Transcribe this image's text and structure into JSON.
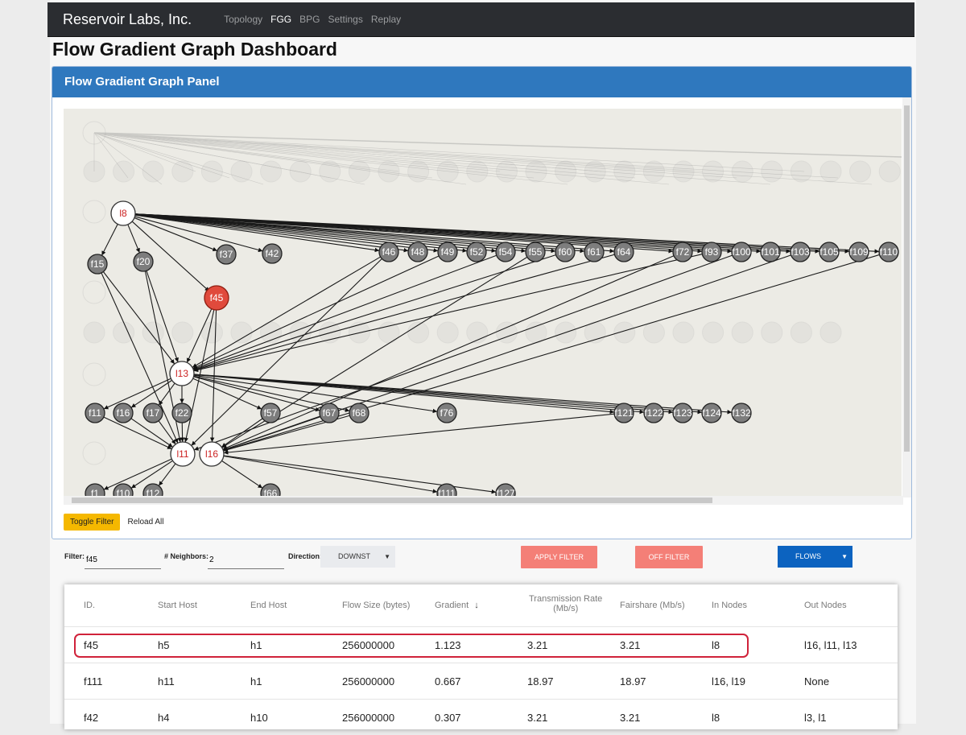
{
  "navbar": {
    "brand": "Reservoir Labs, Inc.",
    "items": [
      {
        "label": "Topology",
        "active": false
      },
      {
        "label": "FGG",
        "active": true
      },
      {
        "label": "BPG",
        "active": false
      },
      {
        "label": "Settings",
        "active": false
      },
      {
        "label": "Replay",
        "active": false
      }
    ]
  },
  "page_title": "Flow Gradient Graph Dashboard",
  "panel": {
    "title": "Flow Gradient Graph Panel",
    "toggle_filter_label": "Toggle Filter",
    "reload_all_label": "Reload All"
  },
  "graph": {
    "link_nodes": [
      "l8",
      "l13",
      "l11",
      "l16"
    ],
    "selected_flow": "f45",
    "flow_nodes": [
      "f15",
      "f20",
      "f37",
      "f42",
      "f46",
      "f48",
      "f49",
      "f52",
      "f54",
      "f55",
      "f60",
      "f61",
      "f64",
      "f72",
      "f93",
      "f100",
      "f101",
      "f103",
      "f105",
      "f109",
      "f110",
      "f45",
      "f11",
      "f16",
      "f17",
      "f22",
      "f57",
      "f67",
      "f68",
      "f76",
      "f121",
      "f122",
      "f123",
      "f124",
      "f132",
      "f1",
      "f10",
      "f12",
      "f66",
      "f111",
      "f127"
    ],
    "colors": {
      "selected_flow": "#e04a3c",
      "flow_node": "#7d7d7d",
      "link_node_text": "#cc2222",
      "canvas": "#ecebe5"
    }
  },
  "filter_bar": {
    "filter_label": "Filter:",
    "filter_value": "f45",
    "neighbors_label": "# Neighbors:",
    "neighbors_value": "2",
    "direction_label": "Direction:",
    "direction_value": "DOWNST",
    "apply_label": "APPLY FILTER",
    "off_label": "OFF FILTER",
    "flows_label": "FLOWS"
  },
  "table": {
    "headers": {
      "id": "ID.",
      "start_host": "Start Host",
      "end_host": "End Host",
      "flow_size": "Flow Size (bytes)",
      "gradient": "Gradient",
      "transmission_rate_1": "Transmission Rate",
      "transmission_rate_2": "(Mb/s)",
      "fairshare": "Fairshare (Mb/s)",
      "in_nodes": "In Nodes",
      "out_nodes": "Out Nodes"
    },
    "sort_indicator": "↓",
    "rows": [
      {
        "id": "f45",
        "start": "h5",
        "end": "h1",
        "size": "256000000",
        "gradient": "1.123",
        "rate": "3.21",
        "fairshare": "3.21",
        "in": "l8",
        "out": "l16, l11, l13"
      },
      {
        "id": "f111",
        "start": "h11",
        "end": "h1",
        "size": "256000000",
        "gradient": "0.667",
        "rate": "18.97",
        "fairshare": "18.97",
        "in": "l16, l19",
        "out": "None"
      },
      {
        "id": "f42",
        "start": "h4",
        "end": "h10",
        "size": "256000000",
        "gradient": "0.307",
        "rate": "3.21",
        "fairshare": "3.21",
        "in": "l8",
        "out": "l3, l1"
      }
    ]
  }
}
